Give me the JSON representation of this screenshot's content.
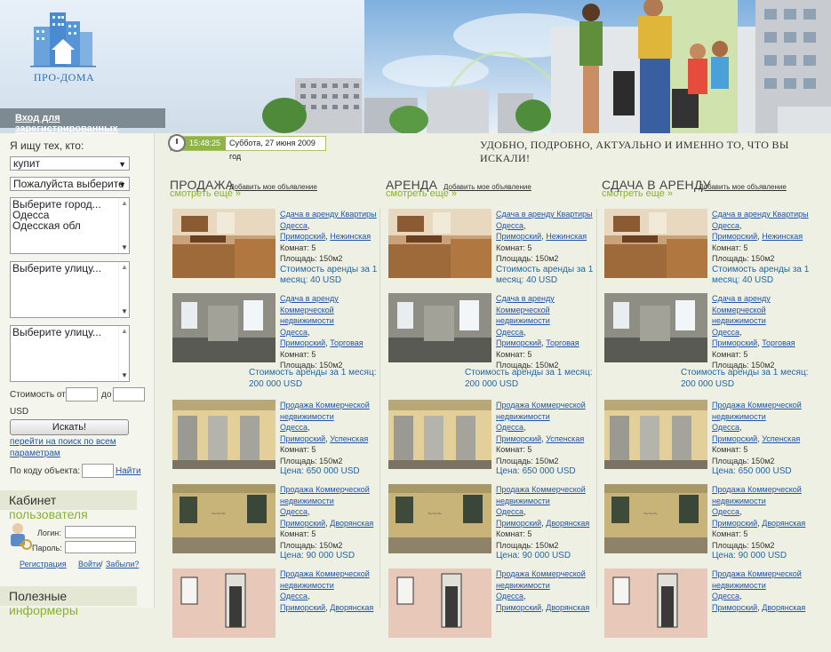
{
  "logo": {
    "text": "ПРО-ДОМА"
  },
  "header": {
    "login_link": "Вход для зарегистрированных"
  },
  "datebar": {
    "time": "15:48:25",
    "date": "Суббота, 27 июня 2009 год"
  },
  "slogan": "УДОБНО, ПОДРОБНО, АКТУАЛЬНО И ИМЕННО ТО, ЧТО ВЫ ИСКАЛИ!",
  "search": {
    "title": "Я ищу тех, кто:",
    "action_select": "купит",
    "type_select": "Пожалуйста выберите",
    "city_list": [
      "Выберите город...",
      "Одесса",
      "Одесская обл"
    ],
    "street_list_1": "Выберите улицу...",
    "street_list_2": "Выберите улицу...",
    "price_from": "Стоимость от",
    "price_to": "до",
    "currency": "USD",
    "button": "Искать!",
    "all_params_link": "перейти на поиск по всем параметрам",
    "by_code": "По коду объекта:",
    "find_link": "Найти"
  },
  "cabinet": {
    "title_a": "Кабинет ",
    "title_b": "пользователя",
    "login_label": "Логин:",
    "password_label": "Пароль:",
    "register": "Регистрация",
    "login": "Войти",
    "sep": "/",
    "forgot": "Забыли?"
  },
  "informers": {
    "title_a": "Полезные ",
    "title_b": "информеры"
  },
  "columns": [
    {
      "title": "ПРОДАЖА",
      "add": "Добавить мое объявление",
      "more": "смотреть еще »"
    },
    {
      "title": "АРЕНДА",
      "add": "Добавить мое объявление",
      "more": "смотреть еще »"
    },
    {
      "title": "СДАЧА В АРЕНДУ",
      "add": "Добавить мое объявление",
      "more": "смотреть еще »"
    }
  ],
  "listings": [
    {
      "title": "Сдача в аренду Квартиры",
      "city": "Одесса",
      "district": "Приморский",
      "street": "Нежинская",
      "rooms": "Комнат: 5",
      "area": "Площадь: 150м2",
      "price": "Стоимость аренды за 1 месяц: 40  USD"
    },
    {
      "title": "Сдача в аренду Коммерческой недвижимости",
      "city": "Одесса",
      "district": "Приморский",
      "street": "Торговая",
      "rooms": "Комнат: 5",
      "area": "Площадь: 150м2",
      "price": "Стоимость аренды за 1 месяц: 200 000  USD"
    },
    {
      "title": "Продажа Коммерческой недвижимости",
      "city": "Одесса",
      "district": "Приморский",
      "street": "Успенская",
      "rooms": "Комнат: 5",
      "area": "Площадь: 150м2",
      "price": "Цена: 650 000  USD"
    },
    {
      "title": "Продажа Коммерческой недвижимости",
      "city": "Одесса",
      "district": "Приморский",
      "street": "Дворянская",
      "rooms": "Комнат: 5",
      "area": "Площадь: 150м2",
      "price": "Цена: 90 000  USD"
    },
    {
      "title": "Продажа Коммерческой недвижимости",
      "city": "Одесса",
      "district": "Приморский",
      "street": "Дворянская"
    }
  ]
}
